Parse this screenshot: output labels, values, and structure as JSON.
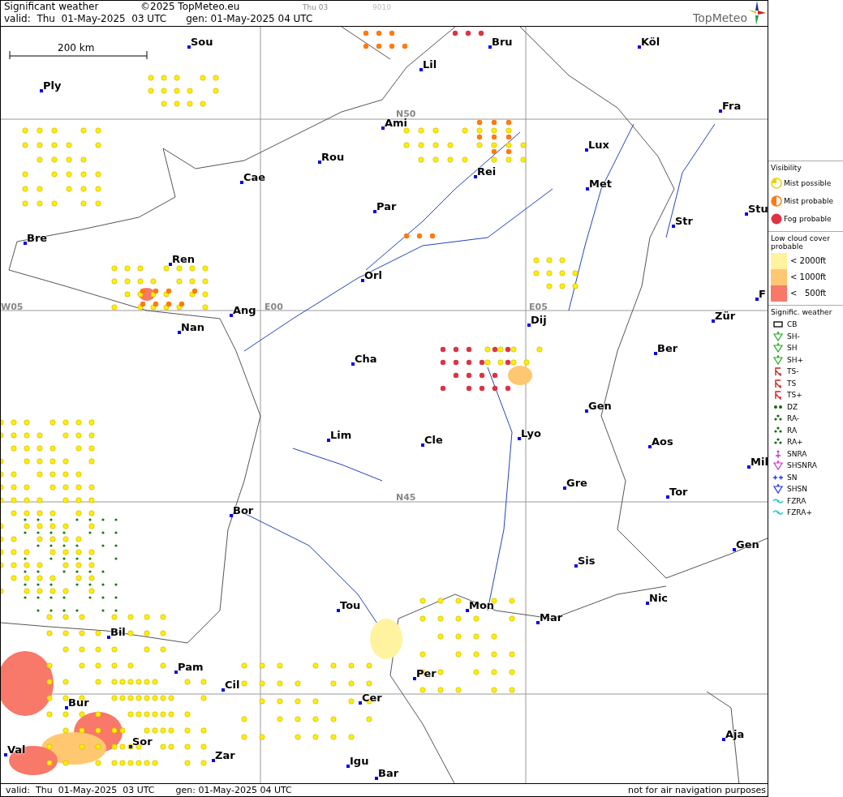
{
  "header": {
    "title": "Significant weather",
    "copyright": "©2025 TopMeteo.eu",
    "run": "Thu 03",
    "code": "9010",
    "valid": "valid:  Thu  01-May-2025  03 UTC",
    "gen": "gen: 01-May-2025 04 UTC",
    "logo": "TopMeteo"
  },
  "map": {
    "scale_label": "200 km",
    "grid_labels": [
      "N50",
      "W05",
      "E00",
      "E05",
      "N45"
    ],
    "cities": [
      "Sou",
      "Bru",
      "Köl",
      "Lil",
      "Ply",
      "Ami",
      "Fra",
      "Lux",
      "Rou",
      "Cae",
      "Rei",
      "Met",
      "Par",
      "Stu",
      "Str",
      "Bre",
      "Ren",
      "Orl",
      "F",
      "Ang",
      "Nan",
      "Dij",
      "Zür",
      "Ber",
      "Cha",
      "Gen",
      "Lim",
      "Cle",
      "Lyo",
      "Aos",
      "Mil",
      "Gre",
      "Tor",
      "Bor",
      "Gen",
      "Sis",
      "Tou",
      "Mon",
      "Nic",
      "Mar",
      "Bil",
      "Pam",
      "Cil",
      "Per",
      "Cer",
      "Bur",
      "Sor",
      "Aja",
      "Val",
      "Zar",
      "Igu",
      "Bar"
    ]
  },
  "legend": {
    "visibility": {
      "title": "Visibility",
      "items": [
        {
          "label": "Mist possible",
          "kind": "possible"
        },
        {
          "label": "Mist probable",
          "kind": "probable"
        },
        {
          "label": "Fog probable",
          "kind": "fog"
        }
      ]
    },
    "low_cloud": {
      "title": "Low cloud cover probable",
      "items": [
        {
          "label": "< 2000ft",
          "color": "#fff3a0"
        },
        {
          "label": "< 1000ft",
          "color": "#ffc870"
        },
        {
          "label": "<   500ft",
          "color": "#f8786a"
        }
      ]
    },
    "weather": {
      "title": "Signific. weather",
      "items": [
        {
          "label": "CB",
          "kind": "cb"
        },
        {
          "label": "SH-",
          "kind": "sh"
        },
        {
          "label": "SH",
          "kind": "sh"
        },
        {
          "label": "SH+",
          "kind": "sh"
        },
        {
          "label": "TS-",
          "kind": "ts"
        },
        {
          "label": "TS",
          "kind": "ts"
        },
        {
          "label": "TS+",
          "kind": "ts"
        },
        {
          "label": "DZ",
          "kind": "dz"
        },
        {
          "label": "RA-",
          "kind": "ra"
        },
        {
          "label": "RA",
          "kind": "ra"
        },
        {
          "label": "RA+",
          "kind": "ra"
        },
        {
          "label": "SNRA",
          "kind": "snra"
        },
        {
          "label": "SHSNRA",
          "kind": "shsnra"
        },
        {
          "label": "SN",
          "kind": "sn"
        },
        {
          "label": "SHSN",
          "kind": "shsn"
        },
        {
          "label": "FZRA",
          "kind": "fzra"
        },
        {
          "label": "FZRA+",
          "kind": "fzra"
        }
      ]
    }
  },
  "footer": {
    "valid": "valid:  Thu  01-May-2025  03 UTC",
    "gen": "gen: 01-May-2025 04 UTC",
    "disclaimer": "not for air navigation purposes"
  }
}
